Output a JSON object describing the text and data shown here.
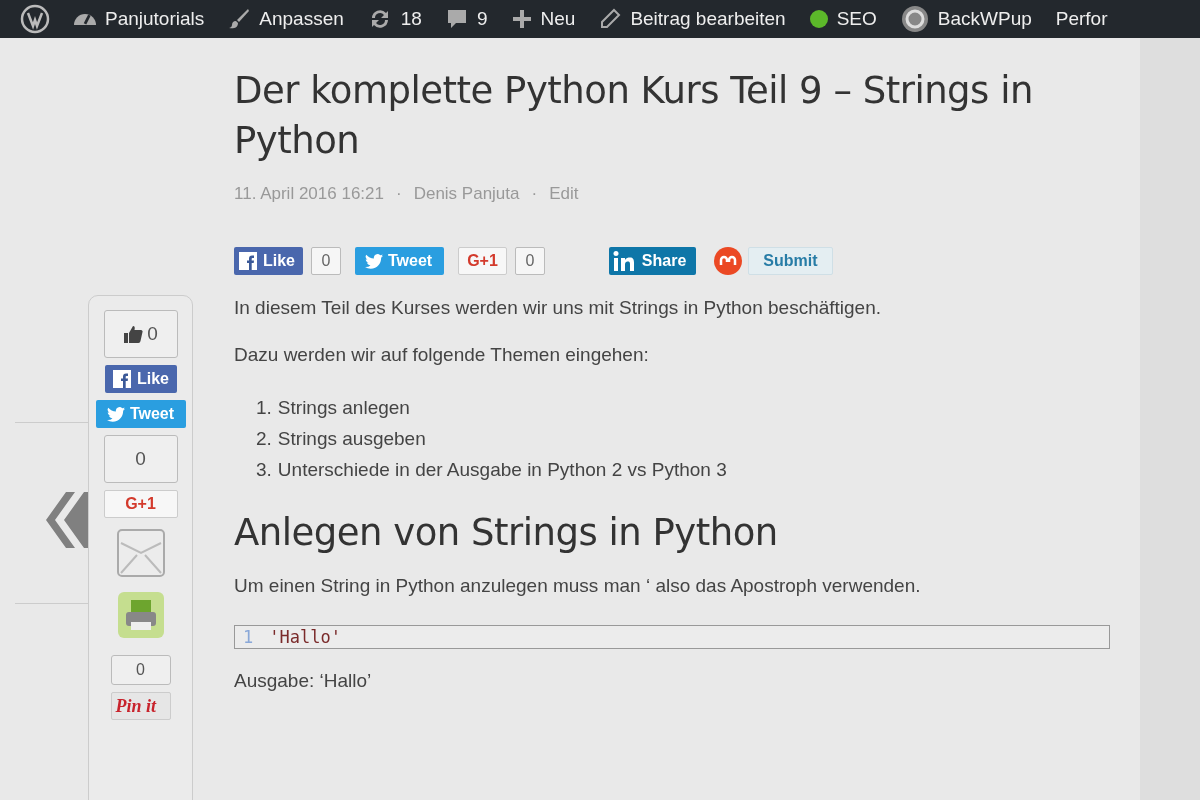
{
  "admin_bar": {
    "items": [
      {
        "kind": "wp-logo"
      },
      {
        "kind": "dashboard",
        "label": "Panjutorials"
      },
      {
        "kind": "brush",
        "label": "Anpassen"
      },
      {
        "kind": "updates",
        "label": "18"
      },
      {
        "kind": "comments",
        "label": "9"
      },
      {
        "kind": "plus",
        "label": "Neu"
      },
      {
        "kind": "pencil",
        "label": "Beitrag bearbeiten"
      },
      {
        "kind": "seo",
        "label": "SEO",
        "color": "#5cb82a"
      },
      {
        "kind": "backup",
        "label": "BackWPup"
      },
      {
        "kind": "text",
        "label": "Perfor"
      }
    ]
  },
  "post": {
    "title": "Der komplette Python Kurs Teil 9 – Strings in Python",
    "meta": [
      "11. April 2016 16:21",
      "Denis Panjuta",
      "Edit"
    ],
    "meta_separator": "·",
    "share_buttons": [
      {
        "kind": "facebook",
        "label": "Like",
        "count": "0"
      },
      {
        "kind": "twitter",
        "label": "Tweet"
      },
      {
        "kind": "gplus",
        "label": "G+1",
        "count": "0"
      },
      {
        "kind": "linkedin",
        "label": "Share"
      },
      {
        "kind": "stumbleupon",
        "label": "Submit"
      }
    ],
    "content": [
      {
        "kind": "paragraph",
        "text": "In diesem Teil des Kurses werden wir uns mit Strings in Python beschäftigen."
      },
      {
        "kind": "paragraph",
        "text": "Dazu werden wir auf folgende Themen eingehen:"
      },
      {
        "kind": "list",
        "items": [
          {
            "number": "1.",
            "text": "Strings anlegen"
          },
          {
            "number": "2.",
            "text": "Strings ausgeben"
          },
          {
            "number": "3.",
            "text": "Unterschiede in der Ausgabe in Python 2 vs Python 3"
          }
        ]
      },
      {
        "kind": "heading",
        "text": "Anlegen von Strings in Python"
      },
      {
        "kind": "paragraph",
        "text": "Um einen String in Python anzulegen muss man ‘ also das Apostroph verwenden."
      },
      {
        "kind": "code",
        "line_number": "1",
        "code": "'Hallo'"
      },
      {
        "kind": "paragraph",
        "text": "Ausgabe: ‘Hallo’"
      }
    ]
  },
  "floating_share_bar": {
    "items": [
      {
        "kind": "like-count",
        "count": "0"
      },
      {
        "kind": "facebook",
        "label": "Like"
      },
      {
        "kind": "twitter",
        "label": "Tweet"
      },
      {
        "kind": "count",
        "count": "0"
      },
      {
        "kind": "gplus",
        "label": "G+1"
      },
      {
        "kind": "email"
      },
      {
        "kind": "print"
      },
      {
        "kind": "count",
        "count": "0"
      },
      {
        "kind": "pinterest",
        "label": "Pin it"
      }
    ]
  }
}
